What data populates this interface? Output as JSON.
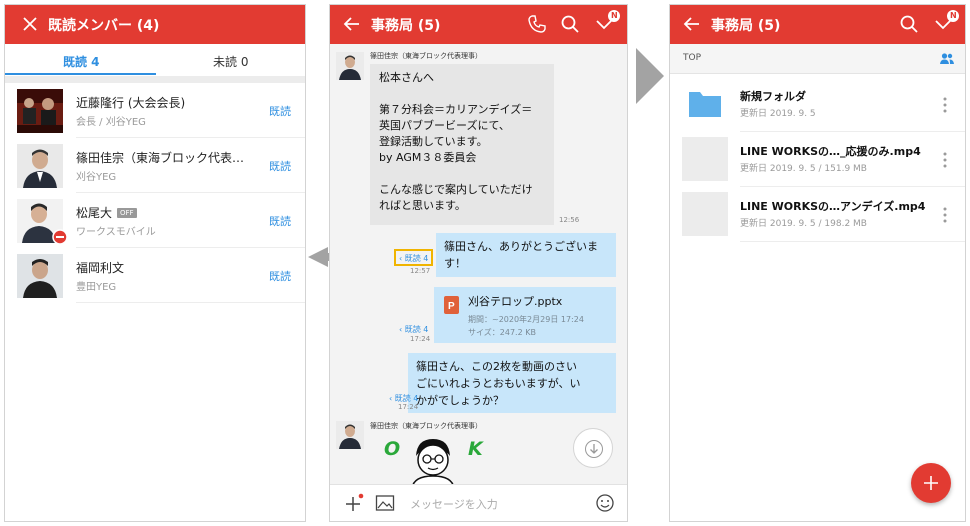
{
  "read_panel": {
    "title": "既読メンバー (4)",
    "tabs": [
      {
        "label": "既読 4",
        "active": true
      },
      {
        "label": "未読 0",
        "active": false
      }
    ],
    "members": [
      {
        "name": "近藤隆行 (大会会長)",
        "subtitle": "会長 / 刈谷YEG",
        "status": "既読",
        "off_badge": ""
      },
      {
        "name": "篠田佳宗（東海ブロック代表…",
        "subtitle": "刈谷YEG",
        "status": "既読",
        "off_badge": ""
      },
      {
        "name": "松尾大",
        "subtitle": "ワークスモバイル",
        "status": "既読",
        "off_badge": "OFF"
      },
      {
        "name": "福岡利文",
        "subtitle": "豊田YEG",
        "status": "既読",
        "off_badge": ""
      }
    ]
  },
  "chat_panel": {
    "title": "事務局 (5)",
    "notif_badge": "N",
    "messages": {
      "m1": {
        "sender": "篠田佳宗（東海ブロック代表理事）",
        "lines": [
          "松本さんへ",
          "",
          "第７分科会＝カリアンデイズ＝",
          "英国パブブービーズにて、",
          "登録活動しています。",
          "by AGM３８委員会",
          "",
          "こんな感じで案内していただけ",
          "ればと思います。"
        ],
        "time": "12:56"
      },
      "m2": {
        "lines": [
          "篠田さん、ありがとうございま",
          "す！"
        ],
        "read": "‹ 既読 4",
        "time": "12:57"
      },
      "m3": {
        "file_name": "刈谷テロップ.pptx",
        "file_period": "期間：~2020年2月29日 17:24",
        "file_size": "サイズ：247.2 KB",
        "read": "‹ 既読 4",
        "time": "17:24"
      },
      "m4": {
        "lines": [
          "篠田さん、この2枚を動画のさい",
          "ごにいれようとおもいますが、い",
          "かがでしょうか？"
        ],
        "read": "‹ 既読 4",
        "time": "17:24"
      },
      "m5": {
        "sender": "篠田佳宗（東海ブロック代表理事）",
        "sticker_left": "O",
        "sticker_right": "K"
      }
    },
    "input_placeholder": "メッセージを入力"
  },
  "folder_panel": {
    "title": "事務局 (5)",
    "notif_badge": "N",
    "breadcrumb": "TOP",
    "files": [
      {
        "name": "新規フォルダ",
        "meta": "更新日 2019. 9. 5",
        "kind": "folder"
      },
      {
        "name": "LINE WORKSの…_応援のみ.mp4",
        "meta": "更新日 2019. 9. 5 / 151.9 MB",
        "kind": "video"
      },
      {
        "name": "LINE WORKSの…アンデイズ.mp4",
        "meta": "更新日 2019. 9. 5 / 198.2 MB",
        "kind": "video"
      }
    ]
  },
  "colors": {
    "header_red": "#e23b32",
    "read_blue": "#2f8fe0",
    "sent_bubble": "#c8e6fa",
    "received_bubble": "#e6e6e6",
    "highlight": "#f0b400",
    "folder_blue": "#5fb0ea",
    "ppt_orange": "#e0613a"
  }
}
